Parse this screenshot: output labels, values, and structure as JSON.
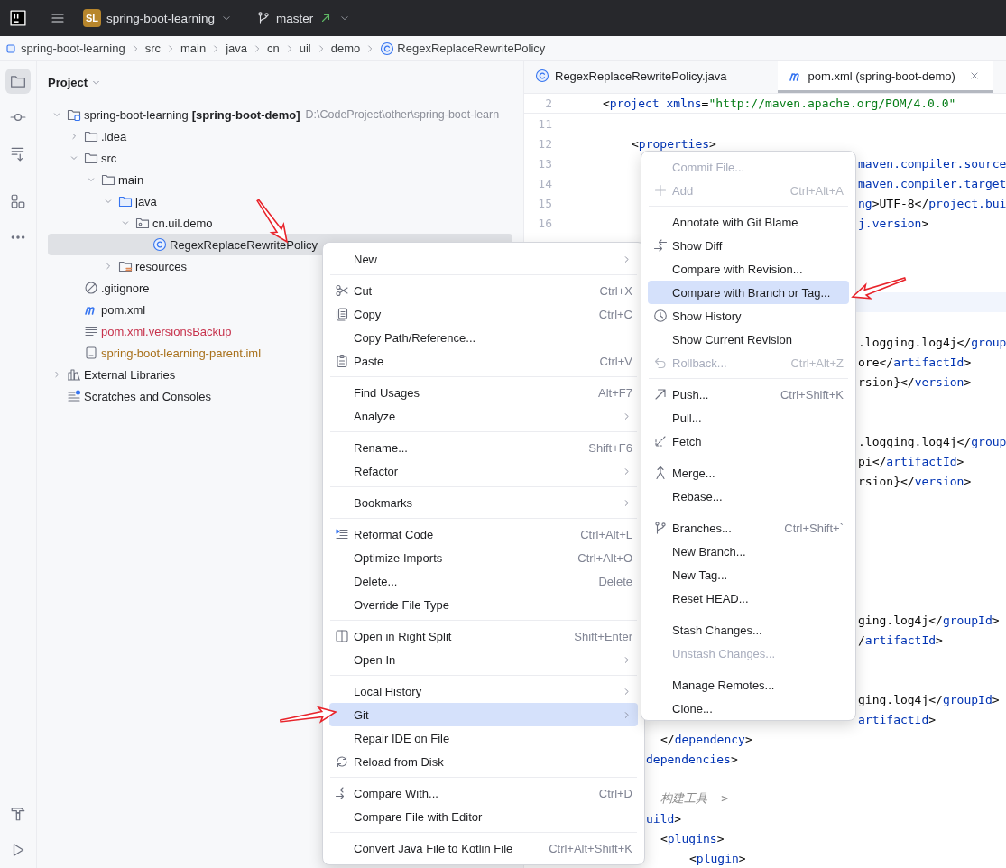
{
  "title_bar": {
    "project_badge": "SL",
    "project": "spring-boot-learning",
    "branch": "master"
  },
  "breadcrumbs": [
    {
      "label": "spring-boot-learning"
    },
    {
      "label": "src"
    },
    {
      "label": "main"
    },
    {
      "label": "java"
    },
    {
      "label": "cn"
    },
    {
      "label": "uil"
    },
    {
      "label": "demo"
    },
    {
      "label": "RegexReplaceRewritePolicy"
    }
  ],
  "tool_strip": {
    "top": [
      {
        "selected": true
      },
      {
        "selected": false
      },
      {
        "selected": false
      },
      {
        "selected": false
      },
      {
        "selected": false
      }
    ]
  },
  "project_panel": {
    "title": "Project",
    "tree": [
      {
        "label": "spring-boot-learning",
        "module": "[spring-boot-demo]",
        "path": "D:\\CodeProject\\other\\spring-boot-learn",
        "kind": "module",
        "expanded": true,
        "selected": false,
        "children": [
          {
            "label": ".idea",
            "kind": "folder",
            "expanded": false,
            "selected": false
          },
          {
            "label": "src",
            "kind": "folder",
            "expanded": true,
            "selected": false,
            "children": [
              {
                "label": "main",
                "kind": "folder",
                "expanded": true,
                "selected": false,
                "children": [
                  {
                    "label": "java",
                    "kind": "source-folder",
                    "expanded": true,
                    "selected": false,
                    "children": [
                      {
                        "label": "cn.uil.demo",
                        "kind": "package",
                        "expanded": true,
                        "selected": false,
                        "children": [
                          {
                            "label": "RegexReplaceRewritePolicy",
                            "kind": "class",
                            "selected": true
                          }
                        ]
                      }
                    ]
                  },
                  {
                    "label": "resources",
                    "kind": "resources-folder",
                    "expanded": false,
                    "selected": false
                  }
                ]
              }
            ]
          },
          {
            "label": ".gitignore",
            "kind": "ignore",
            "selected": false
          },
          {
            "label": "pom.xml",
            "kind": "maven",
            "selected": false
          },
          {
            "label": "pom.xml.versionsBackup",
            "kind": "text",
            "selected": false,
            "color": "#c7324c"
          },
          {
            "label": "spring-boot-learning-parent.iml",
            "kind": "iml",
            "selected": false,
            "color": "#a8701a"
          }
        ]
      },
      {
        "label": "External Libraries",
        "kind": "libraries",
        "expanded": false,
        "selected": false
      },
      {
        "label": "Scratches and Consoles",
        "kind": "scratches",
        "selected": false
      }
    ]
  },
  "editor": {
    "tabs": [
      {
        "label": "RegexReplaceRewritePolicy.java",
        "selected": false,
        "closable": false
      },
      {
        "label": "pom.xml (spring-boot-demo)",
        "selected": true,
        "closable": true
      }
    ],
    "sticky_line": {
      "number": "2",
      "kind": "level0",
      "segments": [
        {
          "text": "<",
          "kind": "plain"
        },
        {
          "text": "project xmlns",
          "kind": "tag"
        },
        {
          "text": "=",
          "kind": "plain"
        },
        {
          "text": "\"http://maven.apache.org/POM/4.0.0\"",
          "kind": "string"
        }
      ]
    },
    "lines": [
      {
        "number": "11",
        "kind": "level0"
      },
      {
        "number": "12",
        "kind": "level1",
        "segments": [
          {
            "text": "<",
            "kind": "plain"
          },
          {
            "text": "properties",
            "kind": "tag"
          },
          {
            "text": ">",
            "kind": "plain"
          }
        ]
      },
      {
        "number": "13",
        "kind": "clip-git",
        "segments": [
          {
            "text": "maven.compiler.source",
            "kind": "tag"
          }
        ]
      },
      {
        "number": "14",
        "kind": "clip-git",
        "segments": [
          {
            "text": "maven.compiler.target",
            "kind": "tag"
          }
        ]
      },
      {
        "number": "15",
        "kind": "clip-git",
        "segments": [
          {
            "text": "ng",
            "kind": "tag"
          },
          {
            "text": ">UTF-8</",
            "kind": "plain"
          },
          {
            "text": "project.bui",
            "kind": "tag"
          }
        ]
      },
      {
        "number": "16",
        "kind": "clip-git",
        "segments": [
          {
            "text": "j.version",
            "kind": "tag"
          },
          {
            "text": ">",
            "kind": "plain"
          }
        ]
      },
      {
        "kind": "blank"
      },
      {
        "kind": "blank"
      },
      {
        "kind": "blank"
      },
      {
        "kind": "blank",
        "current": true
      },
      {
        "kind": "blank"
      },
      {
        "kind": "clip-git",
        "segments": [
          {
            "text": ".logging.log4j</",
            "kind": "plain"
          },
          {
            "text": "group",
            "kind": "tag"
          }
        ]
      },
      {
        "kind": "clip-git",
        "segments": [
          {
            "text": "ore</",
            "kind": "plain"
          },
          {
            "text": "artifactId",
            "kind": "tag"
          },
          {
            "text": ">",
            "kind": "plain"
          }
        ]
      },
      {
        "kind": "clip-git",
        "segments": [
          {
            "text": "rsion}</",
            "kind": "plain"
          },
          {
            "text": "version",
            "kind": "tag"
          },
          {
            "text": ">",
            "kind": "plain"
          }
        ]
      },
      {
        "kind": "blank"
      },
      {
        "kind": "blank"
      },
      {
        "kind": "clip-git",
        "segments": [
          {
            "text": ".logging.log4j</",
            "kind": "plain"
          },
          {
            "text": "group",
            "kind": "tag"
          }
        ]
      },
      {
        "kind": "clip-git",
        "segments": [
          {
            "text": "pi</",
            "kind": "plain"
          },
          {
            "text": "artifactId",
            "kind": "tag"
          },
          {
            "text": ">",
            "kind": "plain"
          }
        ]
      },
      {
        "kind": "clip-git",
        "segments": [
          {
            "text": "rsion}</",
            "kind": "plain"
          },
          {
            "text": "version",
            "kind": "tag"
          },
          {
            "text": ">",
            "kind": "plain"
          }
        ]
      },
      {
        "kind": "blank"
      },
      {
        "kind": "blank"
      },
      {
        "kind": "blank"
      },
      {
        "kind": "blank"
      },
      {
        "kind": "blank"
      },
      {
        "kind": "blank"
      },
      {
        "kind": "clip-git",
        "segments": [
          {
            "text": "ging.log4j</",
            "kind": "plain"
          },
          {
            "text": "groupId",
            "kind": "tag"
          },
          {
            "text": ">",
            "kind": "plain"
          }
        ]
      },
      {
        "kind": "clip-git",
        "segments": [
          {
            "text": "/",
            "kind": "plain"
          },
          {
            "text": "artifactId",
            "kind": "tag"
          },
          {
            "text": ">",
            "kind": "plain"
          }
        ]
      },
      {
        "kind": "blank"
      },
      {
        "kind": "blank"
      },
      {
        "kind": "clip-git",
        "segments": [
          {
            "text": "ging.log4j</",
            "kind": "plain"
          },
          {
            "text": "groupId",
            "kind": "tag"
          },
          {
            "text": ">",
            "kind": "plain"
          }
        ]
      },
      {
        "kind": "clip-git",
        "segments": [
          {
            "text": "artifactId",
            "kind": "tag"
          },
          {
            "text": ">",
            "kind": "plain"
          }
        ]
      },
      {
        "kind": "level2",
        "segments": [
          {
            "text": "</",
            "kind": "plain"
          },
          {
            "text": "dependency",
            "kind": "tag"
          },
          {
            "text": ">",
            "kind": "plain"
          }
        ]
      },
      {
        "kind": "clip-context",
        "segments": [
          {
            "text": "dependencies",
            "kind": "tag"
          },
          {
            "text": ">",
            "kind": "plain"
          }
        ]
      },
      {
        "kind": "blank"
      },
      {
        "kind": "clip-context",
        "segments": [
          {
            "text": "--构建工具-->",
            "kind": "comment"
          }
        ]
      },
      {
        "kind": "clip-context",
        "segments": [
          {
            "text": "uild",
            "kind": "tag"
          },
          {
            "text": ">",
            "kind": "plain"
          }
        ]
      },
      {
        "kind": "level2",
        "segments": [
          {
            "text": "<",
            "kind": "plain"
          },
          {
            "text": "plugins",
            "kind": "tag"
          },
          {
            "text": ">",
            "kind": "plain"
          }
        ]
      },
      {
        "kind": "level3",
        "segments": [
          {
            "text": "<",
            "kind": "plain"
          },
          {
            "text": "plugin",
            "kind": "tag"
          },
          {
            "text": ">",
            "kind": "plain"
          }
        ]
      }
    ]
  },
  "context_menu": {
    "items": [
      {
        "kind": "item",
        "label": "New",
        "submenu": true,
        "selected": false
      },
      {
        "kind": "separator"
      },
      {
        "kind": "item",
        "label": "Cut",
        "shortcut": "Ctrl+X",
        "submenu": false,
        "selected": false
      },
      {
        "kind": "item",
        "label": "Copy",
        "shortcut": "Ctrl+C",
        "submenu": false,
        "selected": false
      },
      {
        "kind": "item",
        "label": "Copy Path/Reference...",
        "submenu": false,
        "selected": false
      },
      {
        "kind": "item",
        "label": "Paste",
        "shortcut": "Ctrl+V",
        "submenu": false,
        "selected": false
      },
      {
        "kind": "separator"
      },
      {
        "kind": "item",
        "label": "Find Usages",
        "shortcut": "Alt+F7",
        "submenu": false,
        "selected": false
      },
      {
        "kind": "item",
        "label": "Analyze",
        "submenu": true,
        "selected": false
      },
      {
        "kind": "separator"
      },
      {
        "kind": "item",
        "label": "Rename...",
        "shortcut": "Shift+F6",
        "submenu": false,
        "selected": false
      },
      {
        "kind": "item",
        "label": "Refactor",
        "submenu": true,
        "selected": false
      },
      {
        "kind": "separator"
      },
      {
        "kind": "item",
        "label": "Bookmarks",
        "submenu": true,
        "selected": false
      },
      {
        "kind": "separator"
      },
      {
        "kind": "item",
        "label": "Reformat Code",
        "shortcut": "Ctrl+Alt+L",
        "submenu": false,
        "selected": false
      },
      {
        "kind": "item",
        "label": "Optimize Imports",
        "shortcut": "Ctrl+Alt+O",
        "submenu": false,
        "selected": false
      },
      {
        "kind": "item",
        "label": "Delete...",
        "shortcut": "Delete",
        "submenu": false,
        "selected": false
      },
      {
        "kind": "item",
        "label": "Override File Type",
        "submenu": false,
        "selected": false
      },
      {
        "kind": "separator"
      },
      {
        "kind": "item",
        "label": "Open in Right Split",
        "shortcut": "Shift+Enter",
        "submenu": false,
        "selected": false
      },
      {
        "kind": "item",
        "label": "Open In",
        "submenu": true,
        "selected": false
      },
      {
        "kind": "separator"
      },
      {
        "kind": "item",
        "label": "Local History",
        "submenu": true,
        "selected": false
      },
      {
        "kind": "item",
        "label": "Git",
        "submenu": true,
        "selected": true
      },
      {
        "kind": "item",
        "label": "Repair IDE on File",
        "submenu": false,
        "selected": false
      },
      {
        "kind": "item",
        "label": "Reload from Disk",
        "submenu": false,
        "selected": false
      },
      {
        "kind": "separator"
      },
      {
        "kind": "item",
        "label": "Compare With...",
        "shortcut": "Ctrl+D",
        "submenu": false,
        "selected": false
      },
      {
        "kind": "item",
        "label": "Compare File with Editor",
        "submenu": false,
        "selected": false
      },
      {
        "kind": "separator"
      },
      {
        "kind": "item",
        "label": "Convert Java File to Kotlin File",
        "shortcut": "Ctrl+Alt+Shift+K",
        "submenu": false,
        "selected": false
      }
    ]
  },
  "git_submenu": {
    "items": [
      {
        "kind": "item",
        "label": "Commit File...",
        "disabled": true,
        "selected": false
      },
      {
        "kind": "item",
        "label": "Add",
        "shortcut": "Ctrl+Alt+A",
        "disabled": true,
        "selected": false
      },
      {
        "kind": "separator"
      },
      {
        "kind": "item",
        "label": "Annotate with Git Blame",
        "disabled": false,
        "selected": false
      },
      {
        "kind": "item",
        "label": "Show Diff",
        "disabled": false,
        "selected": false
      },
      {
        "kind": "item",
        "label": "Compare with Revision...",
        "disabled": false,
        "selected": false
      },
      {
        "kind": "item",
        "label": "Compare with Branch or Tag...",
        "disabled": false,
        "selected": true
      },
      {
        "kind": "item",
        "label": "Show History",
        "disabled": false,
        "selected": false
      },
      {
        "kind": "item",
        "label": "Show Current Revision",
        "disabled": false,
        "selected": false
      },
      {
        "kind": "item",
        "label": "Rollback...",
        "shortcut": "Ctrl+Alt+Z",
        "disabled": true,
        "selected": false
      },
      {
        "kind": "separator"
      },
      {
        "kind": "item",
        "label": "Push...",
        "shortcut": "Ctrl+Shift+K",
        "disabled": false,
        "selected": false
      },
      {
        "kind": "item",
        "label": "Pull...",
        "disabled": false,
        "selected": false
      },
      {
        "kind": "item",
        "label": "Fetch",
        "disabled": false,
        "selected": false
      },
      {
        "kind": "separator"
      },
      {
        "kind": "item",
        "label": "Merge...",
        "disabled": false,
        "selected": false
      },
      {
        "kind": "item",
        "label": "Rebase...",
        "disabled": false,
        "selected": false
      },
      {
        "kind": "separator"
      },
      {
        "kind": "item",
        "label": "Branches...",
        "shortcut": "Ctrl+Shift+`",
        "disabled": false,
        "selected": false
      },
      {
        "kind": "item",
        "label": "New Branch...",
        "disabled": false,
        "selected": false
      },
      {
        "kind": "item",
        "label": "New Tag...",
        "disabled": false,
        "selected": false
      },
      {
        "kind": "item",
        "label": "Reset HEAD...",
        "disabled": false,
        "selected": false
      },
      {
        "kind": "separator"
      },
      {
        "kind": "item",
        "label": "Stash Changes...",
        "disabled": false,
        "selected": false
      },
      {
        "kind": "item",
        "label": "Unstash Changes...",
        "disabled": true,
        "selected": false
      },
      {
        "kind": "separator"
      },
      {
        "kind": "item",
        "label": "Manage Remotes...",
        "disabled": false,
        "selected": false
      },
      {
        "kind": "item",
        "label": "Clone...",
        "disabled": false,
        "selected": false
      }
    ]
  },
  "annotations": [
    {
      "kind": "arrow"
    },
    {
      "kind": "arrow"
    },
    {
      "kind": "arrow"
    }
  ]
}
